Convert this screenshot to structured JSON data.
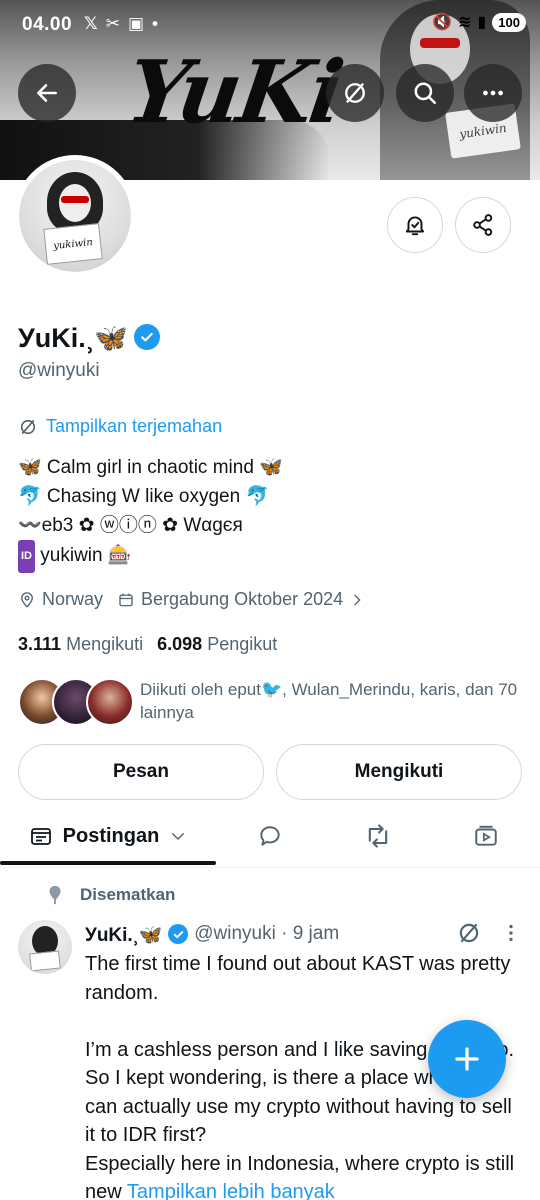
{
  "status_bar": {
    "time": "04.00",
    "left_icons": "𝕏",
    "battery": "100"
  },
  "banner": {
    "title": "YuKi",
    "sign_text": "yukiwin"
  },
  "profile": {
    "display_name": "УuKi.⸒🦋",
    "handle": "@winyuki",
    "translate_label": "Tampilkan terjemahan",
    "bio": [
      "🦋 Calm girl in chaotic mind 🦋",
      "🐬 Chasing W like oxygen 🐬",
      "〰️eb3 ✿ ⓦⓘⓝ ✿ Wαgєя",
      "yukiwin 🎰"
    ],
    "bio_badge": "ID",
    "location": "Norway",
    "joined": "Bergabung Oktober 2024",
    "following_count": "3.111",
    "following_label": "Mengikuti",
    "followers_count": "6.098",
    "followers_label": "Pengikut",
    "followed_by": "Diikuti oleh eput🐦, Wulan_Merindu, karis, dan 70 lainnya",
    "avatar_sign": "yukiwin"
  },
  "actions": {
    "message": "Pesan",
    "following": "Mengikuti"
  },
  "tabs": {
    "posts": "Postingan"
  },
  "pinned": {
    "label": "Disematkan",
    "name": "УuKi.⸒🦋",
    "handle_time": "@winyuki · 9 jam",
    "body_1": "The first time I found out about KAST was pretty random.",
    "body_2": "I’m a cashless person and I like saving in crypto. So I kept wondering, is there a place where I can actually use my crypto without having to sell it to IDR first?",
    "body_3": "Especially here in Indonesia, where crypto is still new",
    "show_more": "Tampilkan lebih banyak"
  },
  "colors": {
    "accent": "#1d9bf0",
    "text": "#0f1419",
    "muted": "#536471"
  }
}
